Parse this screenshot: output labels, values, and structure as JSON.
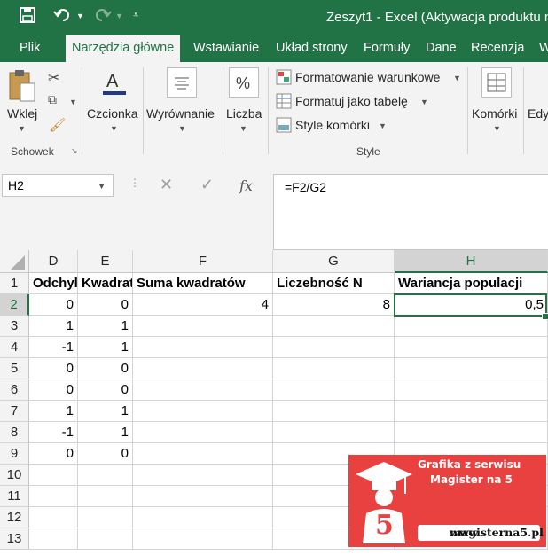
{
  "titlebar": {
    "title": "Zeszyt1 - Excel (Aktywacja produktu n"
  },
  "tabs": [
    "Plik",
    "Narzędzia główne",
    "Wstawianie",
    "Układ strony",
    "Formuły",
    "Dane",
    "Recenzja",
    "W"
  ],
  "ribbon": {
    "paste": "Wklej",
    "clipboard_group": "Schowek",
    "font": "Czcionka",
    "alignment": "Wyrównanie",
    "number": "Liczba",
    "conditional": "Formatowanie warunkowe",
    "as_table": "Formatuj jako tabelę",
    "cell_styles": "Style komórki",
    "styles_group": "Style",
    "cells": "Komórki",
    "edit": "Edy"
  },
  "formula_bar": {
    "name_box": "H2",
    "formula": "=F2/G2",
    "fx": "fx"
  },
  "columns": [
    "D",
    "E",
    "F",
    "G",
    "H"
  ],
  "rows": [
    "1",
    "2",
    "3",
    "4",
    "5",
    "6",
    "7",
    "8",
    "9",
    "10",
    "11",
    "12",
    "13"
  ],
  "header_row": [
    "Odchyl",
    "Kwadrat",
    "Suma kwadratów",
    "Liczebność N",
    "Wariancja populacji"
  ],
  "row2": {
    "F": "4",
    "G": "8",
    "H": "0,5"
  },
  "col_D": [
    "0",
    "1",
    "-1",
    "0",
    "0",
    "1",
    "-1",
    "0"
  ],
  "col_E": [
    "0",
    "1",
    "1",
    "0",
    "0",
    "1",
    "1",
    "0"
  ],
  "watermark": {
    "line1": "Grafika z serwisu",
    "line2": "Magister na 5",
    "www": "www",
    "site": "magisterna5.pl",
    "digit": "5"
  },
  "colors": {
    "excel_green": "#217346",
    "watermark_red": "#e94040"
  }
}
